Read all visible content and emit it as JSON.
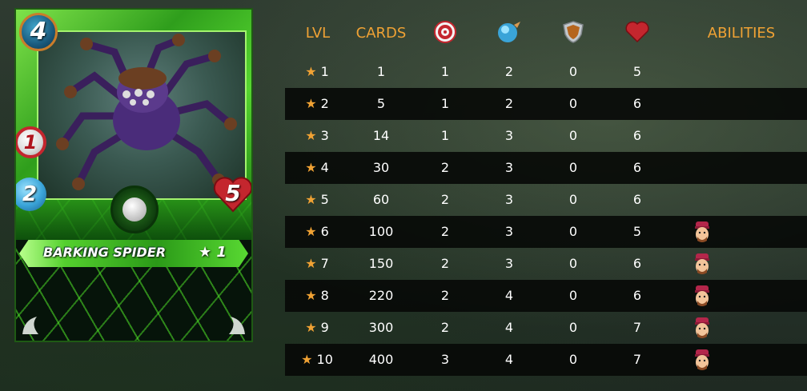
{
  "card": {
    "name": "BARKING SPIDER",
    "stars": "★ 1",
    "mana": "4",
    "melee": "1",
    "speed": "2",
    "health": "5",
    "element_icon": "leaf-gem-icon",
    "colors": {
      "frame": "#3fbf22",
      "name_bar": "#54d02e",
      "mana_ring": "#c97d2b",
      "health": "#c4262e"
    }
  },
  "table": {
    "headers": {
      "lvl": "LVL",
      "cards": "CARDS",
      "attack_icon": "target-icon",
      "speed_icon": "speed-icon",
      "armor_icon": "shield-icon",
      "health_icon": "heart-icon",
      "abilities": "ABILITIES"
    },
    "rows": [
      {
        "lvl": "★ 1",
        "cards": "1",
        "attack": "1",
        "speed": "2",
        "armor": "0",
        "health": "5",
        "ability": null
      },
      {
        "lvl": "★ 2",
        "cards": "5",
        "attack": "1",
        "speed": "2",
        "armor": "0",
        "health": "6",
        "ability": null
      },
      {
        "lvl": "★ 3",
        "cards": "14",
        "attack": "1",
        "speed": "3",
        "armor": "0",
        "health": "6",
        "ability": null
      },
      {
        "lvl": "★ 4",
        "cards": "30",
        "attack": "2",
        "speed": "3",
        "armor": "0",
        "health": "6",
        "ability": null
      },
      {
        "lvl": "★ 5",
        "cards": "60",
        "attack": "2",
        "speed": "3",
        "armor": "0",
        "health": "6",
        "ability": null
      },
      {
        "lvl": "★ 6",
        "cards": "100",
        "attack": "2",
        "speed": "3",
        "armor": "0",
        "health": "5",
        "ability": "ability-face-icon"
      },
      {
        "lvl": "★ 7",
        "cards": "150",
        "attack": "2",
        "speed": "3",
        "armor": "0",
        "health": "6",
        "ability": "ability-face-icon"
      },
      {
        "lvl": "★ 8",
        "cards": "220",
        "attack": "2",
        "speed": "4",
        "armor": "0",
        "health": "6",
        "ability": "ability-face-icon"
      },
      {
        "lvl": "★ 9",
        "cards": "300",
        "attack": "2",
        "speed": "4",
        "armor": "0",
        "health": "7",
        "ability": "ability-face-icon"
      },
      {
        "lvl": "★ 10",
        "cards": "400",
        "attack": "3",
        "speed": "4",
        "armor": "0",
        "health": "7",
        "ability": "ability-face-icon"
      }
    ],
    "colors": {
      "header": "#f0a234",
      "star": "#f0a234",
      "text": "#ffffff",
      "row_dark": "#080a08"
    }
  }
}
